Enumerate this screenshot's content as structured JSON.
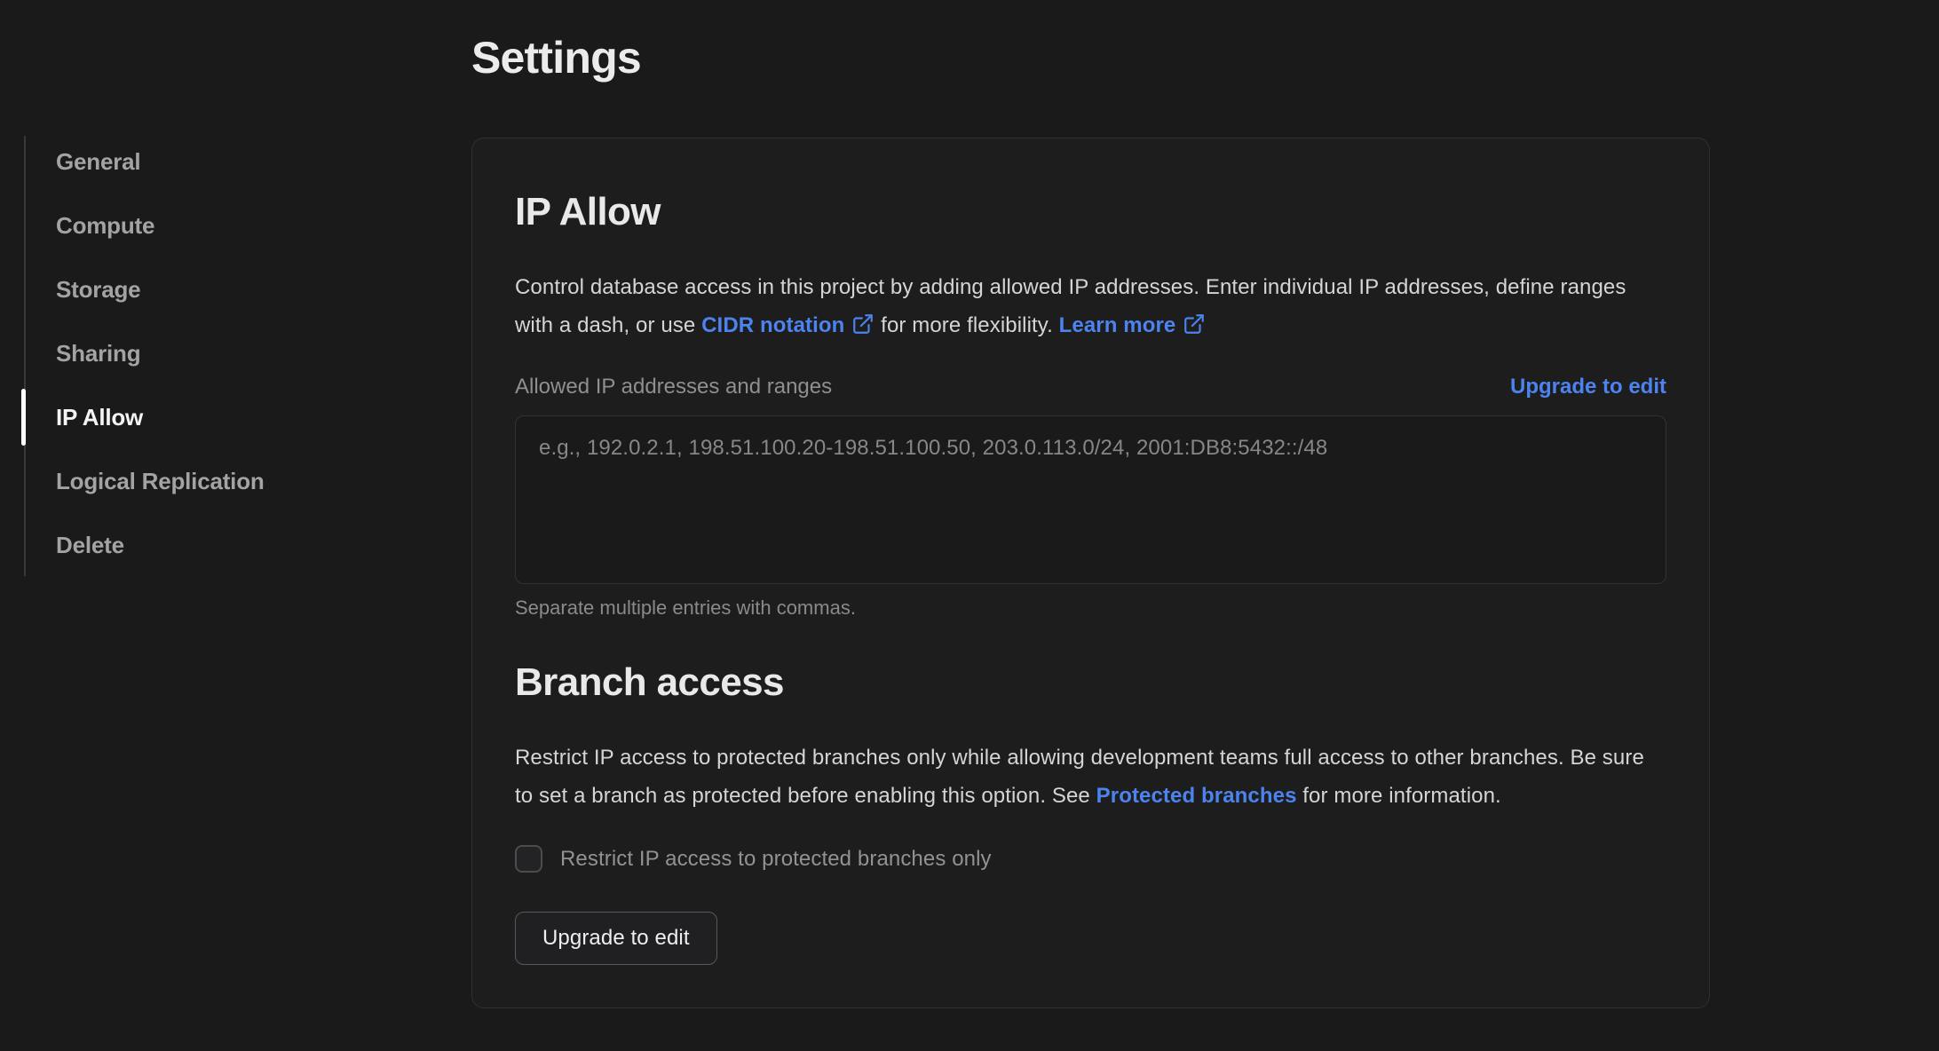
{
  "page": {
    "title": "Settings"
  },
  "sidebar": {
    "items": [
      {
        "label": "General"
      },
      {
        "label": "Compute"
      },
      {
        "label": "Storage"
      },
      {
        "label": "Sharing"
      },
      {
        "label": "IP Allow"
      },
      {
        "label": "Logical Replication"
      },
      {
        "label": "Delete"
      }
    ],
    "active_item": "IP Allow"
  },
  "ip_allow": {
    "heading": "IP Allow",
    "desc_part1": "Control database access in this project by adding allowed IP addresses. Enter individual IP addresses, define ranges with a dash, or use ",
    "cidr_link_label": "CIDR notation",
    "desc_part2": " for more flexibility. ",
    "learn_more_label": "Learn more",
    "field_label": "Allowed IP addresses and ranges",
    "upgrade_link_label": "Upgrade to edit",
    "textarea_placeholder": "e.g., 192.0.2.1, 198.51.100.20-198.51.100.50, 203.0.113.0/24, 2001:DB8:5432::/48",
    "textarea_value": "",
    "helper": "Separate multiple entries with commas."
  },
  "branch_access": {
    "heading": "Branch access",
    "desc_part1": "Restrict IP access to protected branches only while allowing development teams full access to other branches. Be sure to set a branch as protected before enabling this option. See ",
    "protected_link_label": "Protected branches",
    "desc_part2": " for more information.",
    "checkbox_label": "Restrict IP access to protected branches only",
    "checkbox_checked": false,
    "button_label": "Upgrade to edit"
  },
  "colors": {
    "accent_blue": "#4c83ee",
    "page_background": "#1a1a1a",
    "card_background": "#1d1d1e"
  }
}
